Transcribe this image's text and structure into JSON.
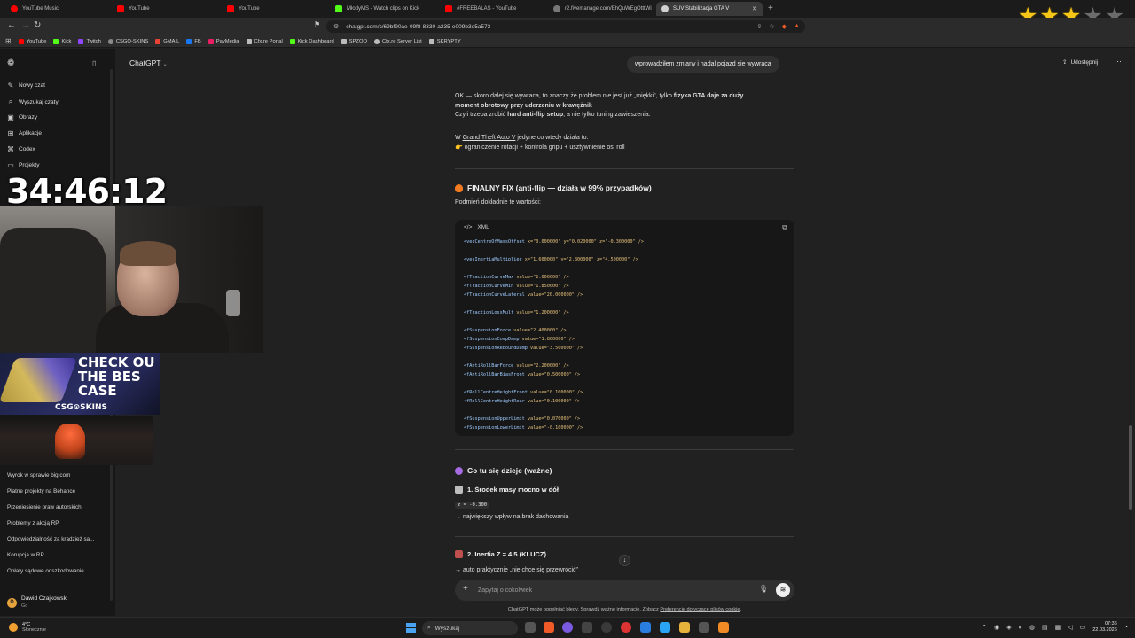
{
  "browser": {
    "tabs": [
      {
        "title": "YouTube Music",
        "color": "#ff0000"
      },
      {
        "title": "YouTube",
        "color": "#ff0000"
      },
      {
        "title": "YouTube",
        "color": "#ff0000"
      },
      {
        "title": "MłodyMS - Watch clips on Kick",
        "color": "#53fc18"
      },
      {
        "title": "#FREEBALAS - YouTube",
        "color": "#ff0000"
      },
      {
        "title": "r2.fivemanage.com/EhQuWEgOtttWi",
        "color": "#9aa0a6"
      },
      {
        "title": "SUV Stabilizacja GTA V",
        "color": "#9aa0a6"
      }
    ],
    "new_tab": "+",
    "url": "chatgpt.com/c/69bf90ae-09f8-8330-a235-e009b3e5a573",
    "stars_filled": 3,
    "stars_total": 5
  },
  "bookmarks": [
    {
      "label": "YouTube",
      "color": "#ff0000"
    },
    {
      "label": "Kick",
      "color": "#53fc18"
    },
    {
      "label": "Twitch",
      "color": "#9146ff"
    },
    {
      "label": "CSGO-SKINS",
      "color": "#8a8a8a"
    },
    {
      "label": "GMAIL",
      "color": "#ea4335"
    },
    {
      "label": "FB",
      "color": "#1877f2"
    },
    {
      "label": "PayMedia",
      "color": "#e91e63"
    },
    {
      "label": "Cfx.re Portal",
      "color": "#bbbbbb"
    },
    {
      "label": "Kick Dashboard",
      "color": "#53fc18"
    },
    {
      "label": "SPZOO",
      "color": "#bbbbbb"
    },
    {
      "label": "Cfx.re Server List",
      "color": "#bbbbbb"
    },
    {
      "label": "SKRYPTY",
      "color": "#bbbbbb"
    }
  ],
  "sidebar": {
    "nav": [
      {
        "label": "Nowy czat",
        "icon": "edit-icon"
      },
      {
        "label": "Wyszukaj czaty",
        "icon": "search-icon"
      },
      {
        "label": "Obrazy",
        "icon": "image-icon"
      },
      {
        "label": "Aplikacje",
        "icon": "apps-icon"
      },
      {
        "label": "Codex",
        "icon": "code-icon"
      },
      {
        "label": "Projekty",
        "icon": "folder-icon"
      }
    ],
    "history": [
      "Wyrok w sprawie big.com",
      "Płatne projekty na Behance",
      "Przeniesienie praw autorskich",
      "Problemy z akcją RP",
      "Odpowiedzialność za kradzież sa...",
      "Korupcja w RP",
      "Opłaty sądowe odszkodowanie"
    ],
    "user": {
      "name": "Dawid Czajkowski",
      "plan": "Go",
      "initial": "D"
    }
  },
  "overlay": {
    "timer": "34:46:12",
    "ad_text": "CHECK OU\nTHE BES\nCASE",
    "ad_brand": "CSG⊙SKINS"
  },
  "chat": {
    "app_title": "ChatGPT",
    "share_label": "Udostępnij",
    "user_message": "wprowadziłem zmiany i nadal pojazd sie wywraca",
    "para1_line1_a": "OK — skoro dalej się wywraca, to znaczy że problem nie jest już „miękki\", tylko ",
    "para1_line1_b": "fizyka GTA daje za duży",
    "para1_line2": "moment obrotowy przy uderzeniu w krawężnik",
    "para1_line3_a": "Czyli trzeba zrobić ",
    "para1_line3_b": "hard anti-flip setup",
    "para1_line3_c": ", a nie tylko tuning zawieszenia.",
    "para2_line1_a": "W ",
    "para2_link": "Grand Theft Auto V",
    "para2_line1_b": " jedyne co wtedy działa to:",
    "para2_line2": "👉 ograniczenie rotacji + kontrola gripu + usztywnienie osi roll",
    "heading_fix": "FINALNY FIX (anti-flip — działa w 99% przypadków)",
    "fix_intro": "Podmień dokładnie te wartości:",
    "code_lang": "XML",
    "code_lines": [
      {
        "tag": "<vecCentreOfMassOffset",
        "attrs": " x=\"0.000000\" y=\"0.020000\" z=\"-0.300000\" />",
        "gap": 0
      },
      {
        "tag": "<vecInertiaMultiplier",
        "attrs": " x=\"1.600000\" y=\"2.800000\" z=\"4.500000\" />",
        "gap": 1
      },
      {
        "tag": "<fTractionCurveMax",
        "attrs": " value=\"2.000000\" />",
        "gap": 1
      },
      {
        "tag": "<fTractionCurveMin",
        "attrs": " value=\"1.850000\" />",
        "gap": 0
      },
      {
        "tag": "<fTractionCurveLateral",
        "attrs": " value=\"20.000000\" />",
        "gap": 0
      },
      {
        "tag": "<fTractionLossMult",
        "attrs": " value=\"1.200000\" />",
        "gap": 1
      },
      {
        "tag": "<fSuspensionForce",
        "attrs": " value=\"2.400000\" />",
        "gap": 1
      },
      {
        "tag": "<fSuspensionCompDamp",
        "attrs": " value=\"1.800000\" />",
        "gap": 0
      },
      {
        "tag": "<fSuspensionReboundDamp",
        "attrs": " value=\"3.500000\" />",
        "gap": 0
      },
      {
        "tag": "<fAntiRollBarForce",
        "attrs": " value=\"2.200000\" />",
        "gap": 1
      },
      {
        "tag": "<fAntiRollBarBiasFront",
        "attrs": " value=\"0.500000\" />",
        "gap": 0
      },
      {
        "tag": "<fRollCentreHeightFront",
        "attrs": " value=\"0.100000\" />",
        "gap": 1
      },
      {
        "tag": "<fRollCentreHeightRear",
        "attrs": " value=\"0.100000\" />",
        "gap": 0
      },
      {
        "tag": "<fSuspensionUpperLimit",
        "attrs": " value=\"0.070000\" />",
        "gap": 1
      },
      {
        "tag": "<fSuspensionLowerLimit",
        "attrs": " value=\"-0.100000\" />",
        "gap": 0
      }
    ],
    "heading_what": "Co tu się dzieje (ważne)",
    "sub1": "1. Środek masy mocno w dół",
    "sub1_code": "z = -0.300",
    "sub1_text": "→ największy wpływ na brak dachowania",
    "sub2": "2. Inertia Z = 4.5 (KLUCZ)",
    "sub2_text": "→ auto praktycznie „nie chce się przewrócić\"",
    "composer_placeholder": "Zapytaj o cokolwiek",
    "disclaimer_a": "ChatGPT może popełniać błędy. Sprawdź ważne informacje. Zobacz ",
    "disclaimer_link": "Preferencje dotyczące plików cookie",
    "disclaimer_b": "."
  },
  "taskbar": {
    "temp": "4°C",
    "weather": "Słonecznie",
    "search_label": "Wyszukaj",
    "time": "07:36",
    "date": "22.03.2026"
  },
  "colors": {
    "accent_orange": "#f05a28",
    "star_gold": "#f5c518",
    "code_tag": "#9ecbff",
    "code_value": "#e5c07b"
  }
}
